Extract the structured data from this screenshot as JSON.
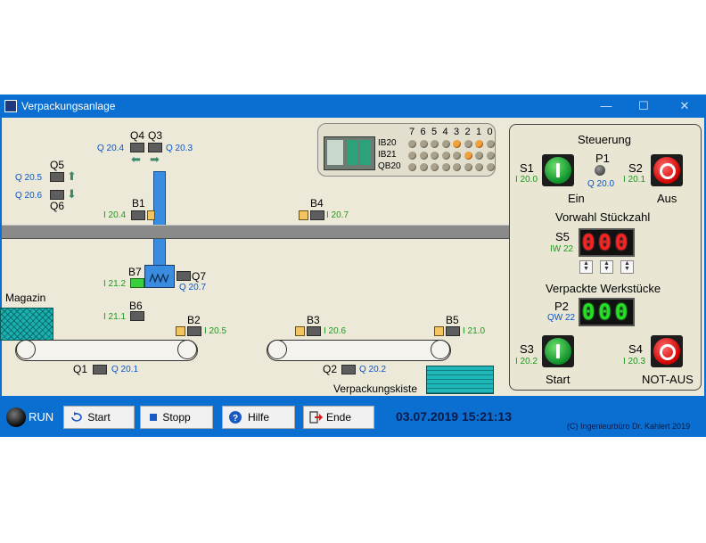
{
  "window": {
    "title": "Verpackungsanlage",
    "btn_min": "—",
    "btn_max": "☐",
    "btn_close": "✕"
  },
  "plant": {
    "q4": "Q4",
    "q3": "Q3",
    "q4_addr": "Q 20.4",
    "q3_addr": "Q 20.3",
    "q5": "Q5",
    "q5_addr": "Q 20.5",
    "q6": "Q6",
    "q6_addr": "Q 20.6",
    "b1": "B1",
    "b1_addr": "I 20.4",
    "b4": "B4",
    "b4_addr": "I 20.7",
    "b7": "B7",
    "b7_addr": "I 21.2",
    "q7": "Q7",
    "q7_addr": "Q 20.7",
    "magazin": "Magazin",
    "b6": "B6",
    "b6_addr": "I 21.1",
    "b2": "B2",
    "b2_addr": "I 20.5",
    "b3": "B3",
    "b3_addr": "I 20.6",
    "b5": "B5",
    "b5_addr": "I 21.0",
    "q1": "Q1",
    "q1_addr": "Q 20.1",
    "q2": "Q2",
    "q2_addr": "Q 20.2",
    "kiste": "Verpackungskiste"
  },
  "plc": {
    "bits": [
      "7",
      "6",
      "5",
      "4",
      "3",
      "2",
      "1",
      "0"
    ],
    "rows": [
      {
        "label": "IB20",
        "states": [
          0,
          0,
          0,
          0,
          1,
          0,
          1,
          0
        ]
      },
      {
        "label": "IB21",
        "states": [
          0,
          0,
          0,
          0,
          0,
          1,
          0,
          0
        ]
      },
      {
        "label": "QB20",
        "states": [
          0,
          0,
          0,
          0,
          0,
          0,
          0,
          0
        ]
      }
    ]
  },
  "control": {
    "title": "Steuerung",
    "s1": "S1",
    "s1_addr": "I 20.0",
    "ein": "Ein",
    "p1": "P1",
    "p1_addr": "Q 20.0",
    "s2": "S2",
    "s2_addr": "I 20.1",
    "aus": "Aus",
    "vorwahl": "Vorwahl Stückzahl",
    "s5": "S5",
    "s5_addr": "IW 22",
    "s5_value": "000",
    "verpackte": "Verpackte Werkstücke",
    "p2": "P2",
    "p2_addr": "QW 22",
    "p2_value": "000",
    "s3": "S3",
    "s3_addr": "I 20.2",
    "start": "Start",
    "s4": "S4",
    "s4_addr": "I 20.3",
    "notaus": "NOT-AUS"
  },
  "toolbar": {
    "run": "RUN",
    "start": "Start",
    "stopp": "Stopp",
    "hilfe": "Hilfe",
    "ende": "Ende",
    "datetime": "03.07.2019  15:21:13",
    "copyright": "(C) Ingenieurbüro Dr. Kahlert 2019"
  },
  "colors": {
    "accent": "#0a6fd0",
    "panel": "#ece9d8",
    "address_blue": "#0a55c9",
    "address_green": "#1a9a1a"
  }
}
